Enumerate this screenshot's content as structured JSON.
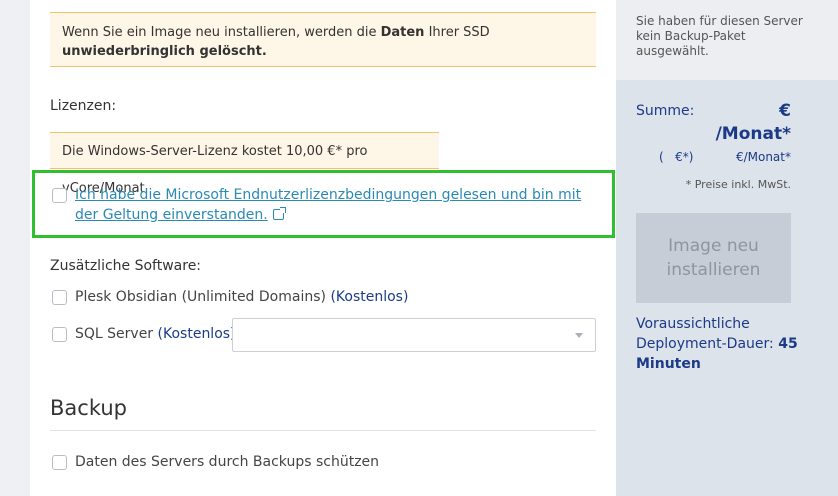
{
  "warning": {
    "pre": "Wenn Sie ein Image neu installieren, werden die ",
    "b1": "Daten",
    "mid": " Ihrer SSD ",
    "b2": "unwiederbringlich gelöscht."
  },
  "licenses": {
    "title": "Lizenzen:",
    "note": "Die Windows-Server-Lizenz kostet 10,00 €* pro vCore/Monat",
    "eula_link": "Ich habe die Microsoft Endnutzerlizenzbedingungen gelesen und bin mit der Geltung einverstanden."
  },
  "software": {
    "title": "Zusätzliche Software:",
    "plesk_label": "Plesk Obsidian (Unlimited Domains) ",
    "plesk_price": "(Kostenlos)",
    "sql_label": "SQL Server ",
    "sql_price": "(Kostenlos)",
    "sql_selected": ""
  },
  "backup": {
    "title": "Backup",
    "checkbox_label": "Daten des Servers durch Backups schützen"
  },
  "sidebar": {
    "no_backup_text": "Sie haben für diesen Server kein Backup-Paket ausgewählt.",
    "sum_label": "Summe:",
    "sum_line1": "€",
    "sum_line2": "/Monat*",
    "sum_sub_left": "(   €*)",
    "sum_sub_right": "€/Monat*",
    "tax_note": "* Preise inkl. MwSt.",
    "button_label": "Image neu installieren",
    "deploy_text": "Voraussichtliche Deployment-Dauer: ",
    "deploy_value": "45 Minuten"
  },
  "colors": {
    "accent_blue": "#1b3a87",
    "link_blue": "#2a8ab3",
    "highlight_green": "#2fbf2f",
    "warning_bg": "#fef6e6"
  }
}
